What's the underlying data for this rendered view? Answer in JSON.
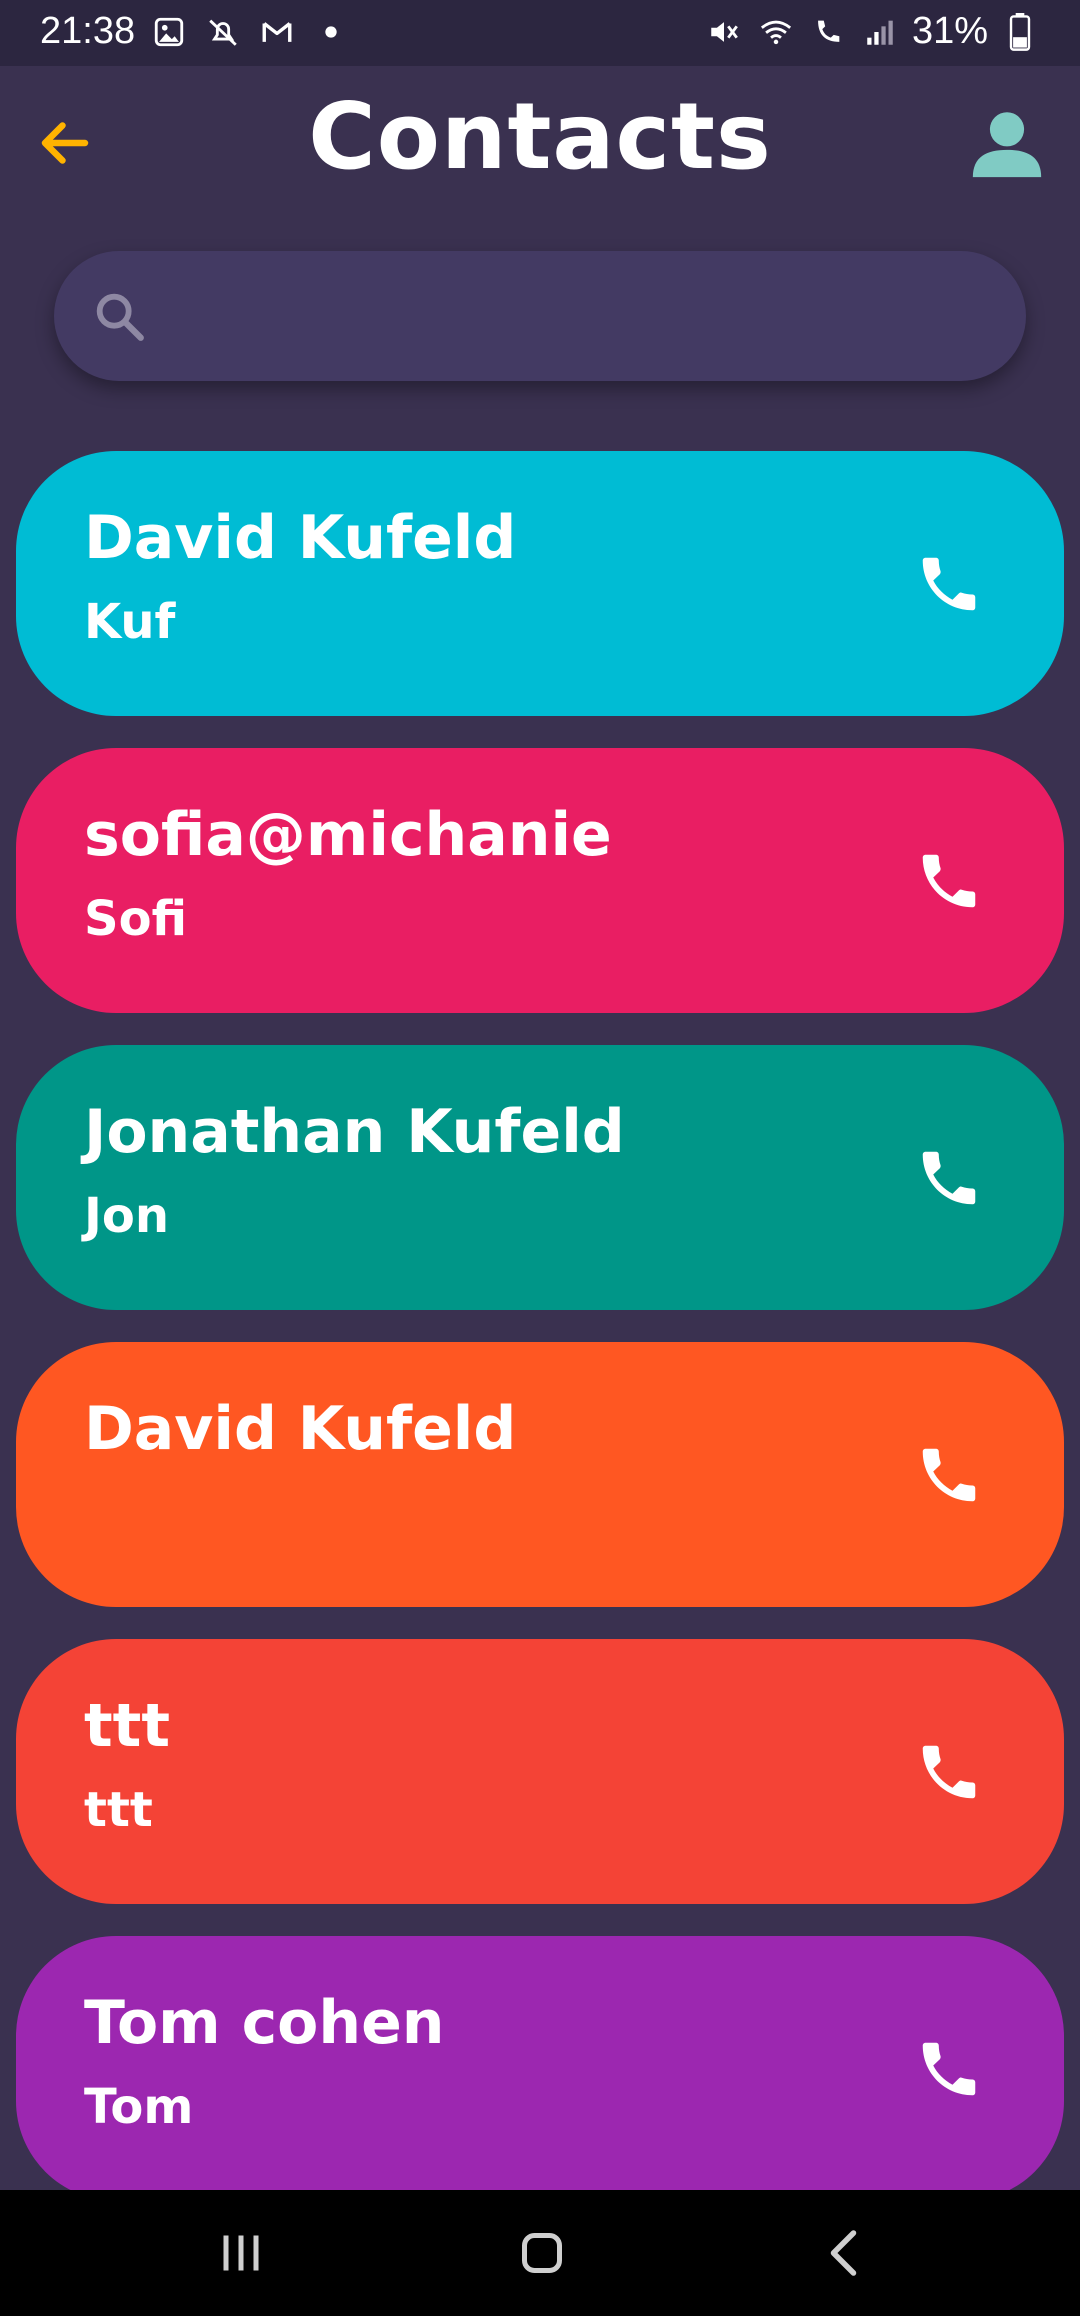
{
  "status_bar": {
    "time": "21:38",
    "battery": "31%",
    "icons_left": [
      "gallery-icon",
      "alarm-off-icon",
      "gmail-icon",
      "dot-icon"
    ],
    "icons_right": [
      "mute-icon",
      "wifi-icon",
      "wifi-calling-icon",
      "signal-icon",
      "battery-icon"
    ]
  },
  "header": {
    "title": "Contacts",
    "back_icon": "arrow-left-icon",
    "profile_icon": "person-icon"
  },
  "search": {
    "icon": "search-icon",
    "placeholder": "",
    "value": ""
  },
  "contacts": [
    {
      "name": "David Kufeld",
      "nickname": "Kuf",
      "color": "#00bcd4"
    },
    {
      "name": "sofia@michanie",
      "nickname": "Sofi",
      "color": "#e91e63"
    },
    {
      "name": "Jonathan Kufeld",
      "nickname": "Jon",
      "color": "#009688"
    },
    {
      "name": "David Kufeld",
      "nickname": "",
      "color": "#ff5722"
    },
    {
      "name": "ttt",
      "nickname": "ttt",
      "color": "#f44336"
    },
    {
      "name": "Tom cohen",
      "nickname": "Tom",
      "color": "#9c27b0"
    }
  ],
  "colors": {
    "background": "#3a3150",
    "status_bar": "#2c2640",
    "search_bar": "#433a63",
    "back_arrow": "#ffb300",
    "profile_icon": "#80cbc4",
    "nav_bar": "#000000"
  },
  "nav": {
    "recent_icon": "recent-apps-icon",
    "home_icon": "home-icon",
    "back_icon": "back-icon"
  }
}
